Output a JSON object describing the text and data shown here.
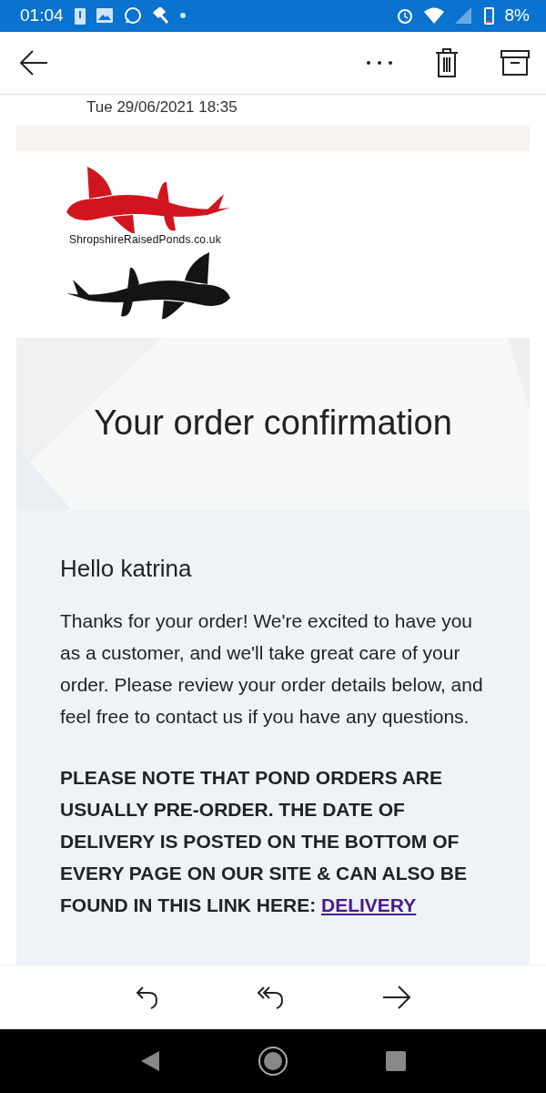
{
  "status_bar": {
    "time": "01:04",
    "battery": "8%"
  },
  "email": {
    "date": "Tue 29/06/2021 18:35",
    "logo_text": "ShropshireRaisedPonds.co.uk",
    "title": "Your order confirmation",
    "greeting": "Hello katrina",
    "intro": "Thanks for your order! We're excited to have you as a customer, and we'll take great care of your order. Please review your order details below, and feel free to contact us if you have any questions.",
    "note_text": "PLEASE NOTE THAT POND ORDERS ARE USUALLY PRE-ORDER. THE DATE OF DELIVERY IS POSTED ON THE BOTTOM OF EVERY PAGE ON OUR SITE & CAN ALSO BE FOUND IN THIS LINK HERE:",
    "note_link": "DELIVERY"
  }
}
